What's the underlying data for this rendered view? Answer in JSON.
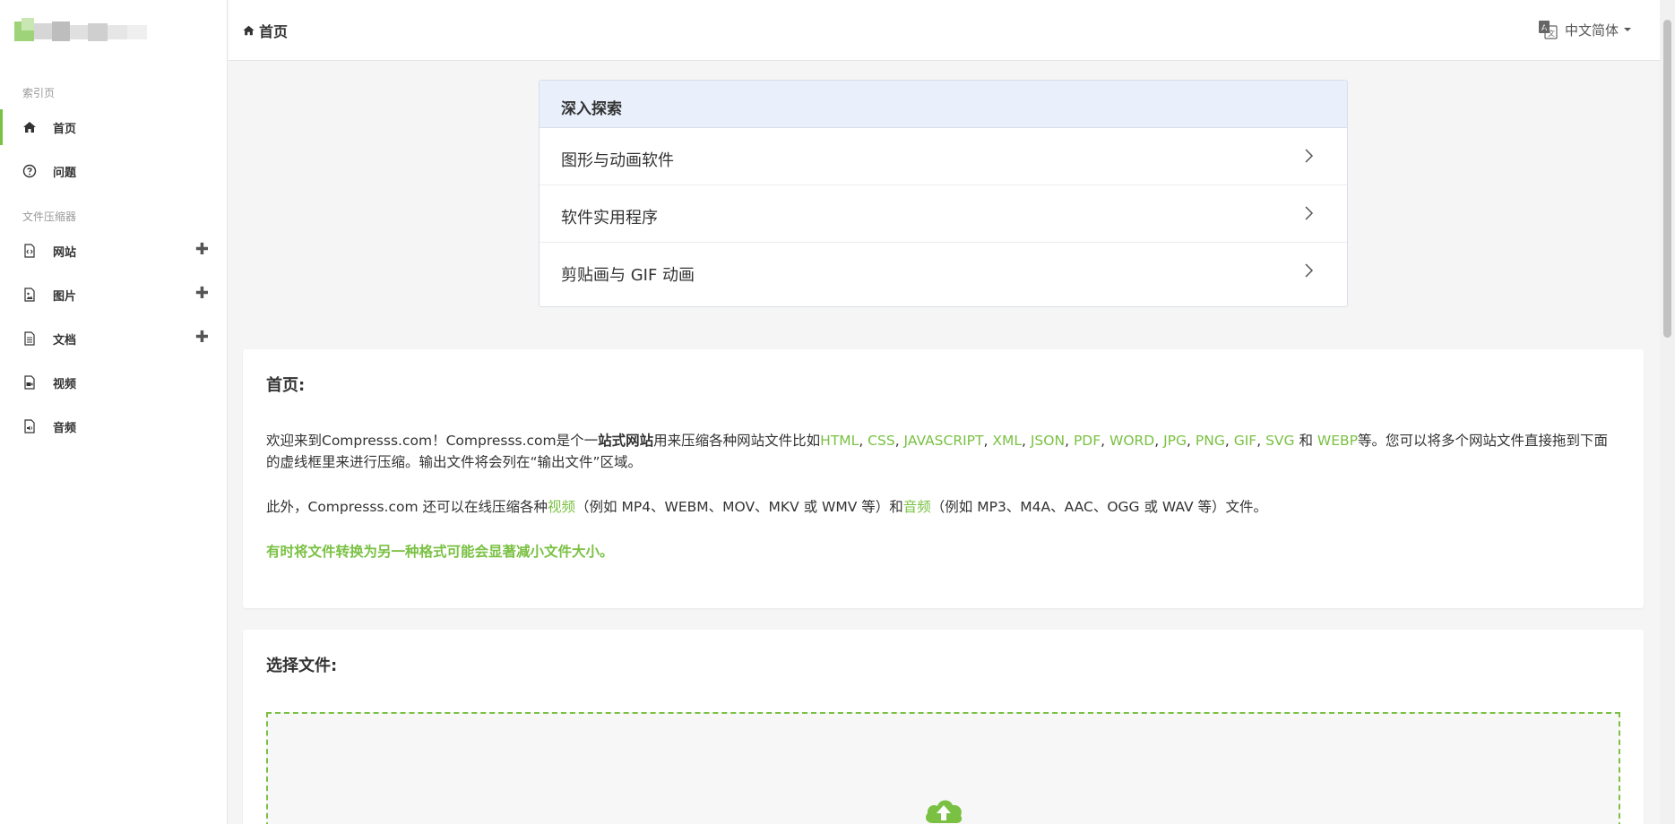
{
  "sidebar": {
    "sections": [
      {
        "title": "索引页"
      },
      {
        "title": "文件压缩器"
      }
    ],
    "items": [
      {
        "label": "首页",
        "icon": "home-icon",
        "active": true
      },
      {
        "label": "问题",
        "icon": "question-circle-icon"
      },
      {
        "label": "网站",
        "icon": "code-file-icon",
        "expandable": true
      },
      {
        "label": "图片",
        "icon": "image-file-icon",
        "expandable": true
      },
      {
        "label": "文档",
        "icon": "document-file-icon",
        "expandable": true
      },
      {
        "label": "视频",
        "icon": "video-file-icon"
      },
      {
        "label": "音频",
        "icon": "audio-file-icon"
      }
    ],
    "plus_symbol": "✚"
  },
  "topbar": {
    "breadcrumb": "首页",
    "language": "中文简体"
  },
  "explore": {
    "title": "深入探索",
    "items": [
      {
        "label": "图形与动画软件"
      },
      {
        "label": "软件实用程序"
      },
      {
        "label": "剪贴画与 GIF 动画"
      }
    ]
  },
  "intro": {
    "title": "首页:",
    "p1": {
      "before": "欢迎来到Compresss.com！Compresss.com是个一",
      "bold": "站式网站",
      "after": "用来压缩各种网站文件比如",
      "formats": [
        "HTML",
        "CSS",
        "JAVASCRIPT",
        "XML",
        "JSON",
        "PDF",
        "WORD",
        "JPG",
        "PNG",
        "GIF",
        "SVG"
      ],
      "and": "和",
      "last_format": "WEBP",
      "tail": "等。您可以将多个网站文件直接拖到下面的虚线框里来进行压缩。输出文件将会列在“输出文件”区域。"
    },
    "p2": {
      "before": "此外，Compresss.com 还可以在线压缩各种",
      "video_link": "视频",
      "video_examples": "（例如 MP4、WEBM、MOV、MKV 或 WMV 等）和",
      "audio_link": "音频",
      "audio_examples": "（例如 MP3、M4A、AAC、OGG 或 WAV 等）文件。"
    },
    "tip": "有时将文件转换为另一种格式可能会显著减小文件大小。"
  },
  "select": {
    "title": "选择文件:"
  },
  "colors": {
    "accent": "#7ac143",
    "explore_header": "#e9f0fb",
    "background": "#f5f5f5"
  }
}
